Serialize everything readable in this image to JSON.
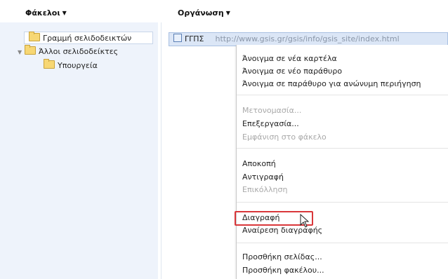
{
  "header": {
    "folders_label": "Φάκελοι",
    "organize_label": "Οργάνωση"
  },
  "tree": {
    "bookmarks_bar": "Γραμμή σελιδοδεικτών",
    "other_bookmarks": "Άλλοι σελιδοδείκτες",
    "ministries": "Υπουργεία"
  },
  "bookmark": {
    "title": "ΓΓΠΣ",
    "url": "http://www.gsis.gr/gsis/info/gsis_site/index.html"
  },
  "menu": {
    "open_new_tab": "Άνοιγμα σε νέα καρτέλα",
    "open_new_window": "Άνοιγμα σε νέο παράθυρο",
    "open_incognito": "Άνοιγμα σε παράθυρο για ανώνυμη περιήγηση",
    "rename": "Μετονομασία...",
    "edit": "Επεξεργασία...",
    "show_in_folder": "Εμφάνιση στο φάκελο",
    "cut": "Αποκοπή",
    "copy": "Αντιγραφή",
    "paste": "Επικόλληση",
    "delete": "Διαγραφή",
    "undo_delete": "Αναίρεση διαγραφής",
    "add_page": "Προσθήκη σελίδας...",
    "add_folder": "Προσθήκη φακέλου..."
  },
  "colors": {
    "left_pane": "#eef3fb",
    "selected_row": "#dbe6f6",
    "highlight_box": "#d9373a"
  }
}
